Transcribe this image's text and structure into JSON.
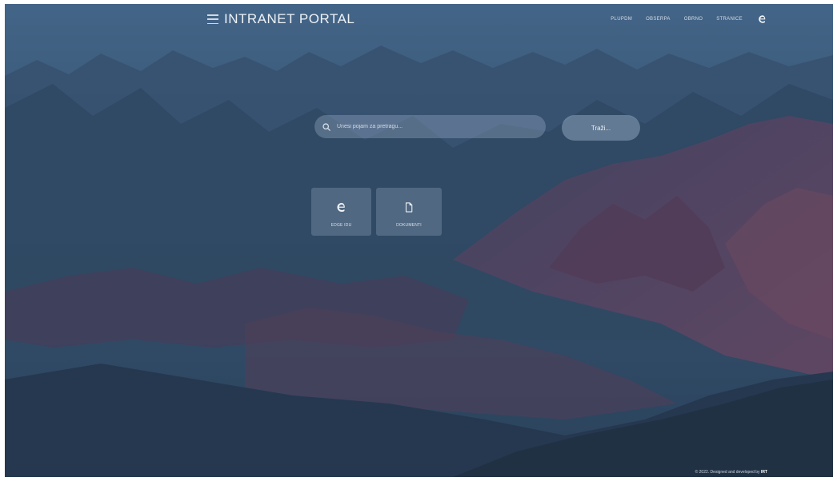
{
  "header": {
    "brand": "INTRANET PORTAL",
    "nav": [
      {
        "label": "PLUPDM"
      },
      {
        "label": "OBSERPA"
      },
      {
        "label": "OBRNO"
      },
      {
        "label": "STRANICE"
      }
    ],
    "nav_icon": "edge-browser-icon"
  },
  "search": {
    "placeholder": "Unesi pojam za pretragu...",
    "button_label": "Traži..."
  },
  "tiles": [
    {
      "label": "EDGE IDU",
      "icon": "edge-browser-icon"
    },
    {
      "label": "DOKUMENTI",
      "icon": "document-icon"
    }
  ],
  "footer": {
    "text": "© 2022. Designed and developed by",
    "author": "IRT"
  },
  "colors": {
    "sky": "#3b5b7d",
    "mountain_dark": "#253a52",
    "mountain_rose": "#6b3f5a",
    "overlay": "#2f4a68"
  }
}
